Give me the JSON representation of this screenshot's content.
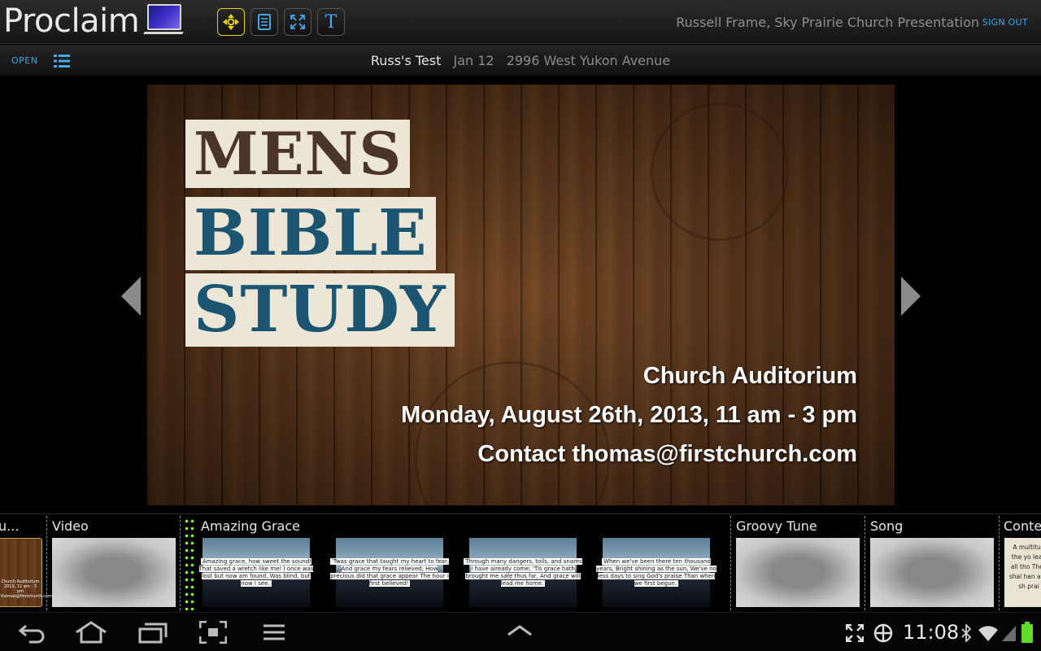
{
  "app": {
    "logo_text": "Proclaim",
    "user_label": "Russell Frame, Sky Prairie Church Presentation",
    "sign_out": "SIGN OUT"
  },
  "toolbar": {
    "tools": [
      "move-icon",
      "slides-icon",
      "fullscreen-icon",
      "text-icon"
    ],
    "text_tool_glyph": "T",
    "accent_color": "#e8d21c"
  },
  "subbar": {
    "open_label": "OPEN",
    "presentation_name": "Russ's Test",
    "date": "Jan 12",
    "address": "2996 West Yukon Avenue"
  },
  "slide": {
    "title_line1": "MENS",
    "title_line2": "BIBLE",
    "title_line3": "STUDY",
    "location": "Church Auditorium",
    "datetime": "Monday, August 26th, 2013, 11 am - 3 pm",
    "contact": "Contact thomas@firstchurch.com"
  },
  "filmstrip": {
    "items": [
      {
        "label": "u...",
        "thumb": "wood",
        "thumb_text": "Church Auditorium 2013, 11 am - 3 pm thomas@firstchurch.com"
      },
      {
        "label": "Video",
        "thumb": "gray"
      },
      {
        "label": "Amazing Grace",
        "thumb": "grace"
      },
      {
        "label": "Groovy Tune",
        "thumb": "gray"
      },
      {
        "label": "Song",
        "thumb": "gray"
      },
      {
        "label": "Conter",
        "thumb": "content",
        "thumb_text": "A multitud the yo leah all tho They shal han and sh prai"
      }
    ],
    "grace_slides": [
      "Amazing grace, how sweet the sound! That saved a wretch like me! I once was lost but now am found, Was blind, but now I see.",
      "'Twas grace that taught my heart to fear, And grace my fears relieved; How precious did that grace appear The hour I first believed!",
      "Through many dangers, toils, and snares I have already come; 'Tis grace hath brought me safe thus far, And grace will lead me home.",
      "When we've been there ten thousand years, Bright shining as the sun, We've no less days to sing God's praise Than when we first begun."
    ]
  },
  "system": {
    "time": "11:08"
  }
}
